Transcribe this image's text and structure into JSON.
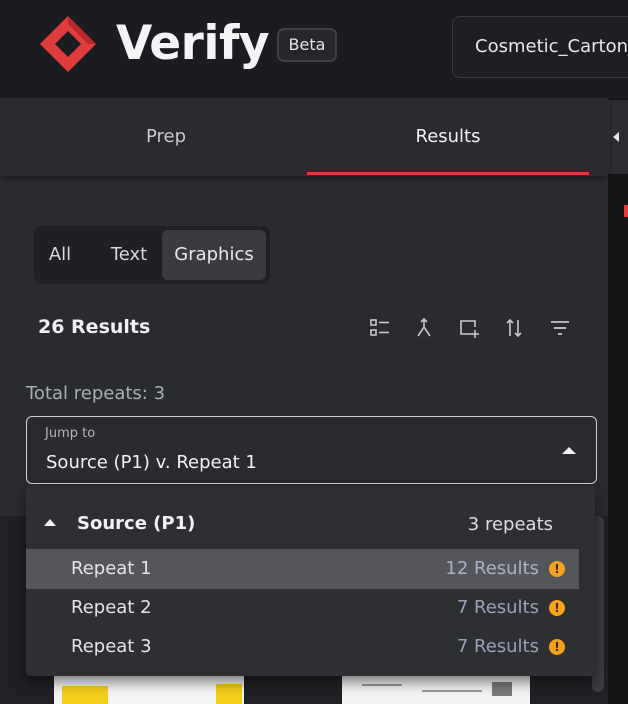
{
  "header": {
    "brand": "Verify",
    "badge": "Beta",
    "file_name": "Cosmetic_Carton_"
  },
  "tabs": [
    {
      "label": "Prep",
      "active": false
    },
    {
      "label": "Results",
      "active": true
    }
  ],
  "filter": {
    "options": [
      "All",
      "Text",
      "Graphics"
    ],
    "selected": "Graphics"
  },
  "results": {
    "count_label": "26 Results",
    "toolbar_icons": [
      "list-view-icon",
      "merge-icon",
      "add-region-icon",
      "sort-icon",
      "filter-icon"
    ]
  },
  "repeats": {
    "total_label": "Total repeats: 3"
  },
  "jump_to": {
    "label": "Jump to",
    "value": "Source (P1) v. Repeat 1",
    "expanded": true
  },
  "dropdown": {
    "group_title": "Source (P1)",
    "group_count": "3 repeats",
    "items": [
      {
        "label": "Repeat 1",
        "count": "12 Results",
        "warning": "!",
        "active": true
      },
      {
        "label": "Repeat 2",
        "count": "7 Results",
        "warning": "!",
        "active": false
      },
      {
        "label": "Repeat 3",
        "count": "7 Results",
        "warning": "!",
        "active": false
      }
    ]
  },
  "colors": {
    "accent_red": "#e03c3c",
    "warning_orange": "#f5a11a",
    "panel_bg": "#2a2b2f",
    "header_bg": "#1b1c1f"
  }
}
